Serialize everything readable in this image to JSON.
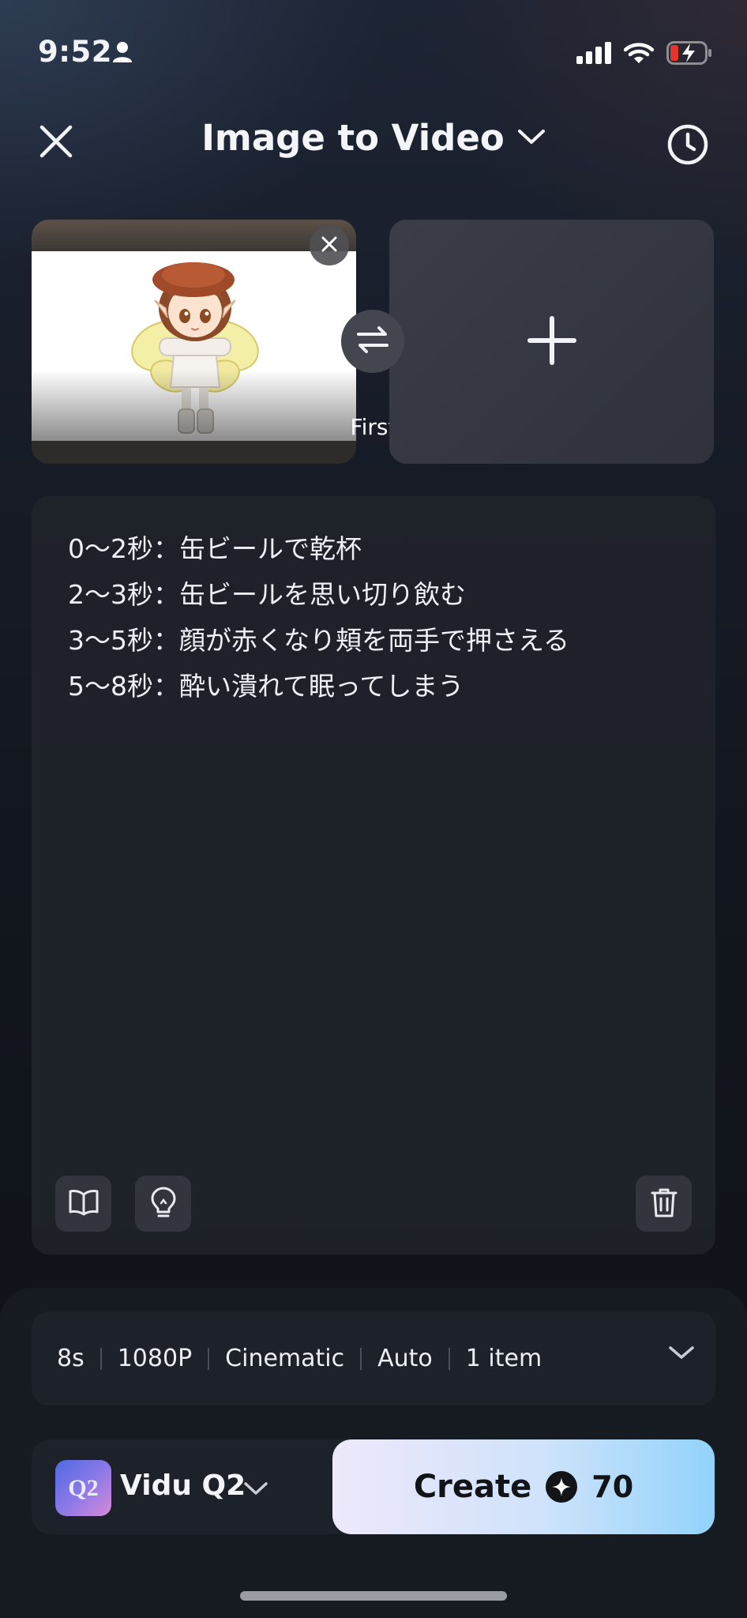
{
  "status_bar": {
    "time": "9:52"
  },
  "header": {
    "title": "Image to Video"
  },
  "image_slots": {
    "first_label": "First"
  },
  "prompt": {
    "lines": [
      "0〜2秒：缶ビールで乾杯",
      "2〜3秒：缶ビールを思い切り飲む",
      "3〜5秒：顔が赤くなり頬を両手で押さえる",
      "5〜8秒：酔い潰れて眠ってしまう"
    ]
  },
  "settings": {
    "duration": "8s",
    "resolution": "1080P",
    "style": "Cinematic",
    "ratio": "Auto",
    "count": "1 item"
  },
  "model": {
    "logo_text": "Q2",
    "name": "Vidu Q2"
  },
  "create": {
    "label": "Create",
    "cost": "70"
  },
  "colors": {
    "accent_start": "#eee8fb",
    "accent_end": "#92d3fb",
    "battery_low": "#e5342c"
  },
  "icons": [
    "close-icon",
    "chevron-down-icon",
    "history-clock-icon",
    "swap-icon",
    "plus-icon",
    "book-icon",
    "lightbulb-icon",
    "trash-icon",
    "sparkle-icon"
  ]
}
